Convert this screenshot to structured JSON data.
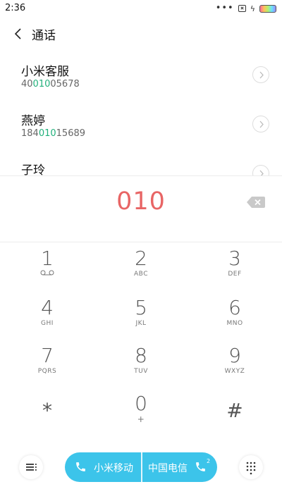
{
  "status_bar": {
    "time": "2:36",
    "icons": [
      "more-dots-icon",
      "no-sim-icon",
      "charging-bolt-icon",
      "battery-icon"
    ]
  },
  "nav": {
    "back_icon": "chevron-left-icon",
    "title": "通话"
  },
  "contacts": [
    {
      "name": "小米客服",
      "number_prefix": "40",
      "number_match": "010",
      "number_suffix": "05678"
    },
    {
      "name": "燕婷",
      "number_prefix": "184",
      "number_match": "010",
      "number_suffix": "15689"
    },
    {
      "name": "子玲",
      "number_prefix": "",
      "number_match": "",
      "number_suffix": ""
    }
  ],
  "entry": {
    "number": "010",
    "delete_icon": "backspace-icon"
  },
  "keypad": [
    {
      "digit": "1",
      "letters": "voicemail-icon"
    },
    {
      "digit": "2",
      "letters": "ABC"
    },
    {
      "digit": "3",
      "letters": "DEF"
    },
    {
      "digit": "4",
      "letters": "GHI"
    },
    {
      "digit": "5",
      "letters": "JKL"
    },
    {
      "digit": "6",
      "letters": "MNO"
    },
    {
      "digit": "7",
      "letters": "PQRS"
    },
    {
      "digit": "8",
      "letters": "TUV"
    },
    {
      "digit": "9",
      "letters": "WXYZ"
    },
    {
      "digit": "*",
      "letters": ""
    },
    {
      "digit": "0",
      "letters": "+"
    },
    {
      "digit": "#",
      "letters": ""
    }
  ],
  "bottom": {
    "menu_icon": "menu-list-icon",
    "sim1_label": "小米移动",
    "sim2_label": "中国电信",
    "sim2_badge": "2",
    "keypad_toggle_icon": "keypad-grid-icon"
  },
  "colors": {
    "accent_call": "#3cc4ea",
    "entry_number": "#e86565",
    "match_highlight": "#21b07b"
  }
}
